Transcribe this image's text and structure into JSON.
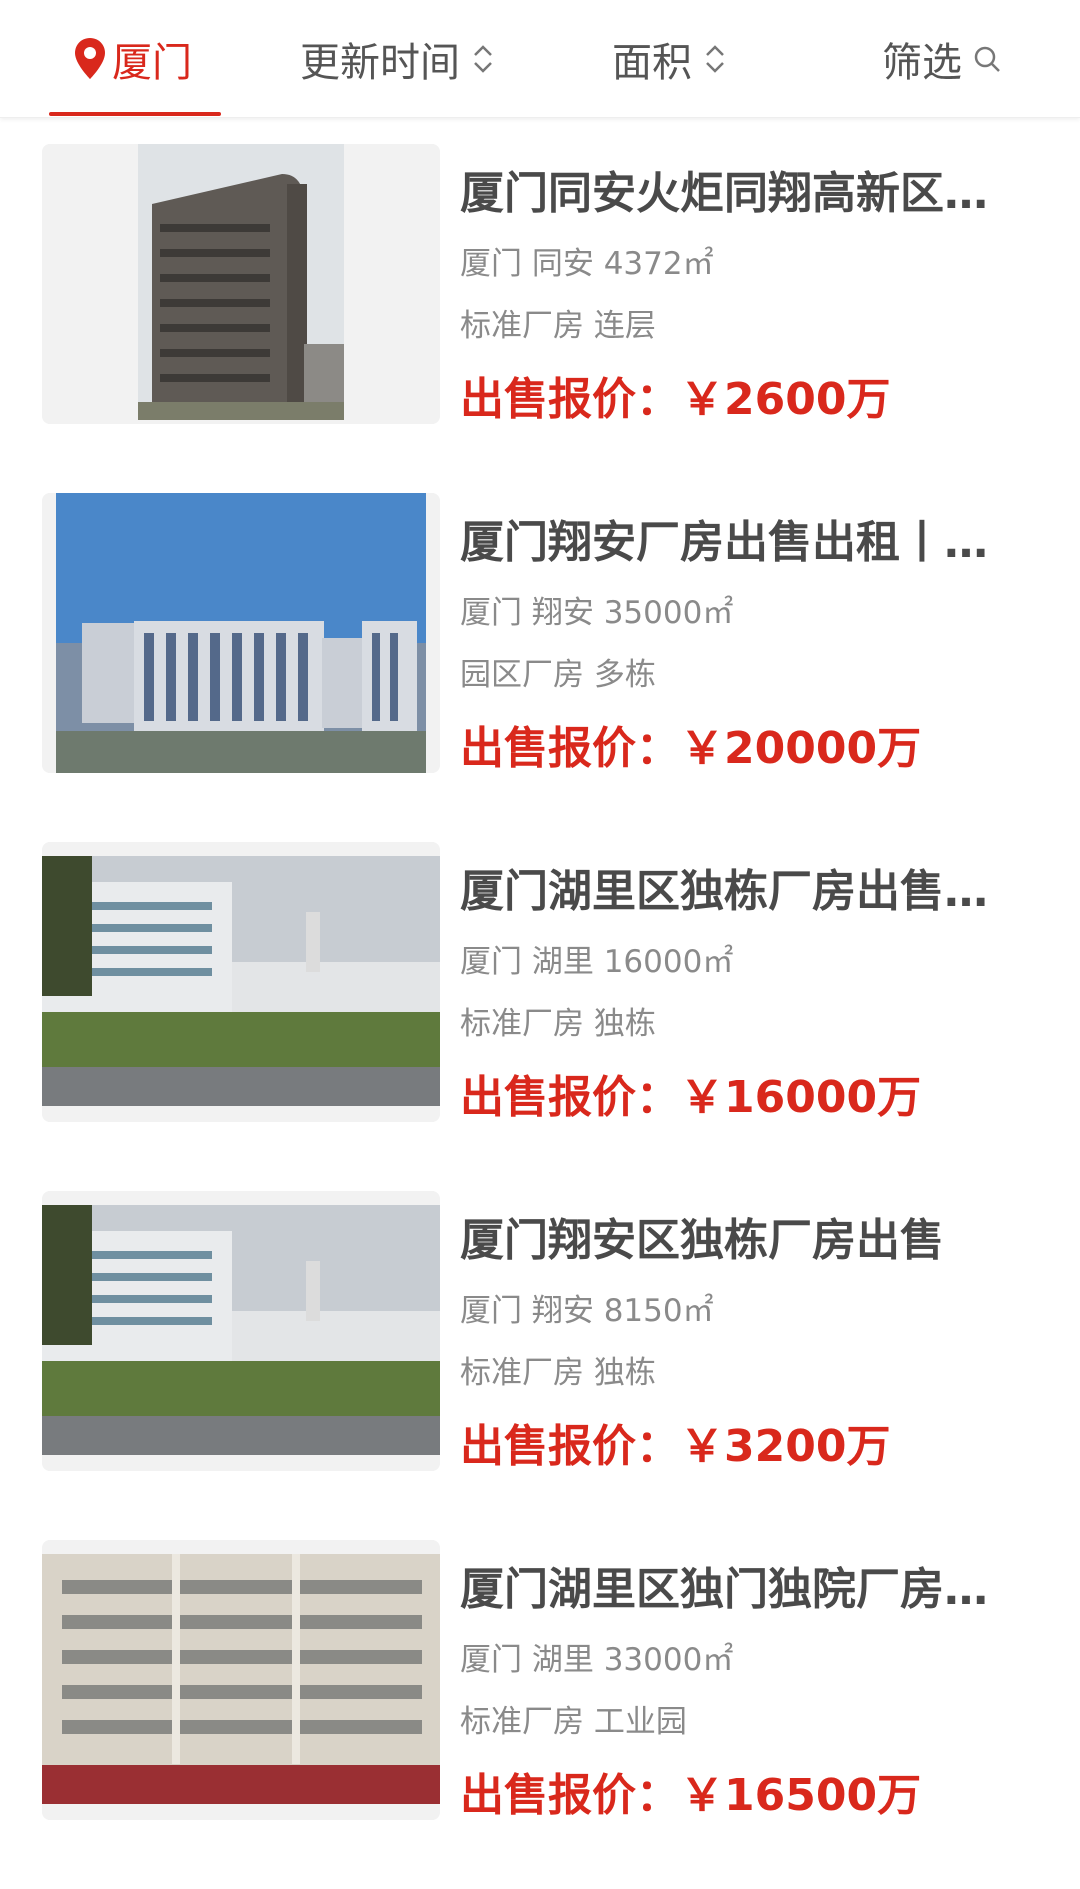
{
  "filterbar": {
    "city": "厦门",
    "update_time": "更新时间",
    "area": "面积",
    "filter": "筛选"
  },
  "listings": [
    {
      "title": "厦门同安火炬同翔高新区…",
      "location": "厦门 同安 4372㎡",
      "type": "标准厂房 连层",
      "price_label": "出售报价：",
      "price": "￥2600万"
    },
    {
      "title": "厦门翔安厂房出售出租丨…",
      "location": "厦门 翔安 35000㎡",
      "type": "园区厂房 多栋",
      "price_label": "出售报价：",
      "price": "￥20000万"
    },
    {
      "title": "厦门湖里区独栋厂房出售…",
      "location": "厦门 湖里 16000㎡",
      "type": "标准厂房 独栋",
      "price_label": "出售报价：",
      "price": "￥16000万"
    },
    {
      "title": "厦门翔安区独栋厂房出售",
      "location": "厦门 翔安 8150㎡",
      "type": "标准厂房 独栋",
      "price_label": "出售报价：",
      "price": "￥3200万"
    },
    {
      "title": "厦门湖里区独门独院厂房…",
      "location": "厦门 湖里 33000㎡",
      "type": "标准厂房 工业园",
      "price_label": "出售报价：",
      "price": "￥16500万"
    }
  ],
  "colors": {
    "accent": "#d9281c",
    "title": "#4a4a4a",
    "meta": "#8a8a8a"
  }
}
